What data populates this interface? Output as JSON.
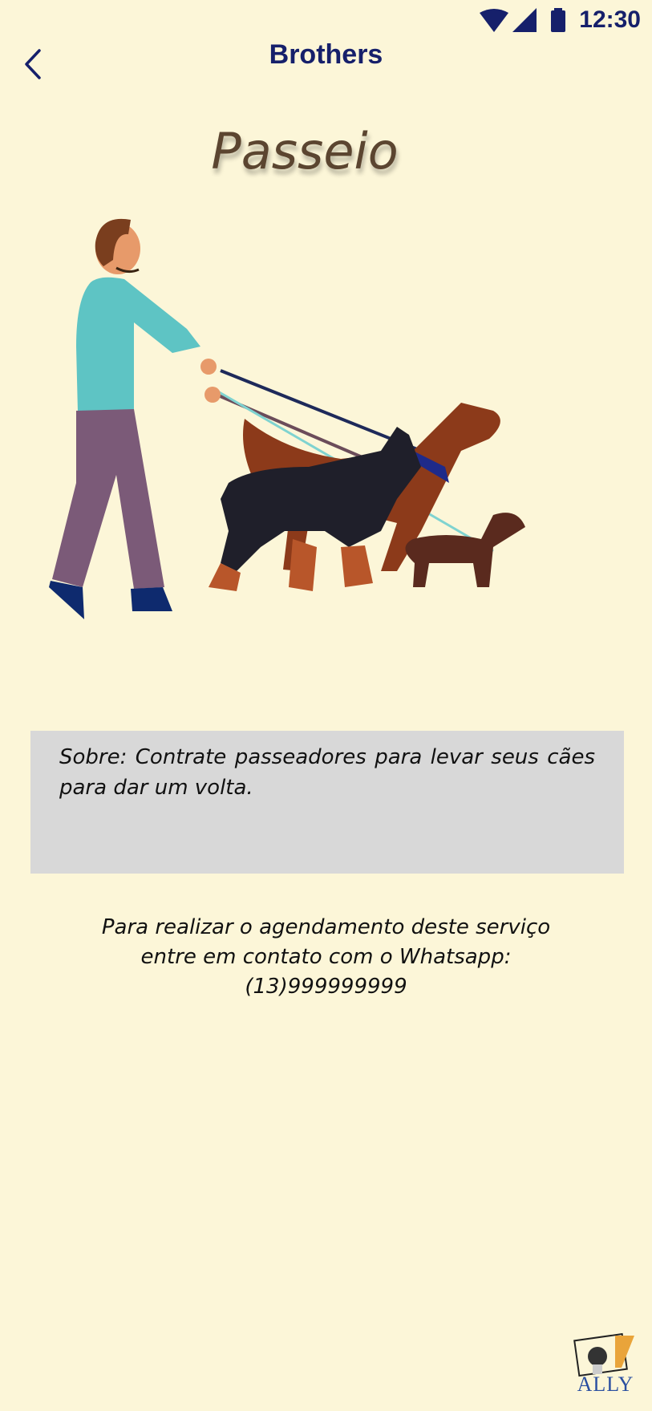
{
  "status_bar": {
    "time": "12:30"
  },
  "app_bar": {
    "title": "Brothers"
  },
  "service": {
    "title": "Passeio"
  },
  "about": {
    "text": "Sobre: Contrate passeadores para levar seus cães para dar um volta."
  },
  "contact": {
    "line1": "Para realizar o agendamento deste serviço",
    "line2": "entre em contato com o Whatsapp:",
    "phone": "(13)999999999"
  },
  "logo": {
    "text": "ALLY"
  },
  "icons": [
    "wifi-icon",
    "signal-icon",
    "battery-icon",
    "back-arrow-icon"
  ],
  "colors": {
    "background": "#fcf6d8",
    "accent": "#16206b",
    "title": "#5b4530",
    "about_box": "#d8d8d8"
  }
}
